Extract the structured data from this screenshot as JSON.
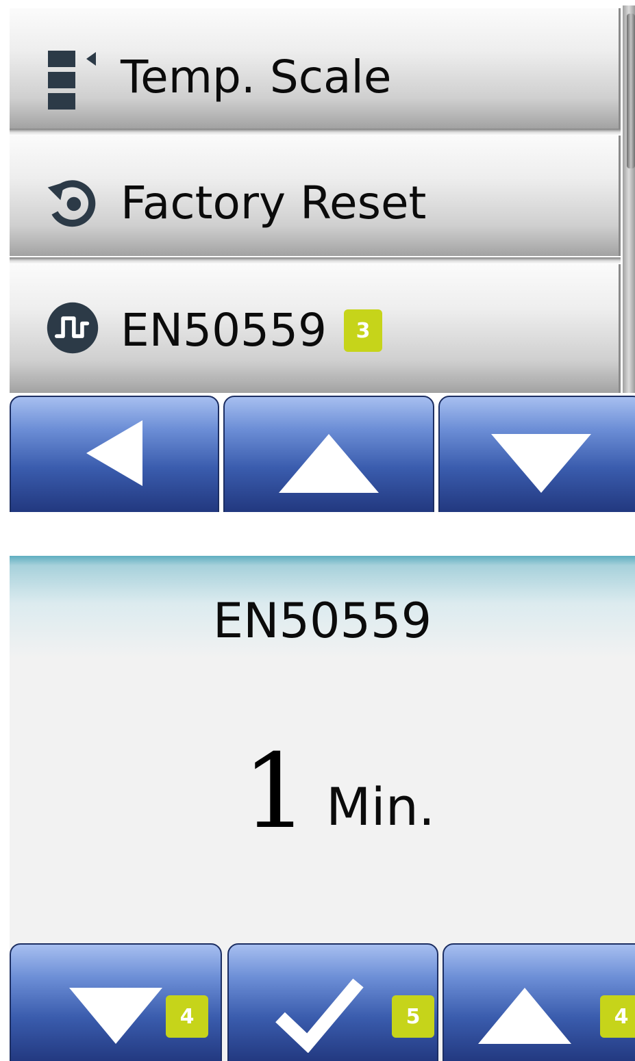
{
  "panel1": {
    "menu": [
      {
        "label": "Temp. Scale",
        "icon": "temp-scale-icon"
      },
      {
        "label": "Factory Reset",
        "icon": "reset-icon"
      },
      {
        "label": "EN50559",
        "icon": "en50559-icon",
        "badge": "3"
      }
    ],
    "nav": [
      {
        "icon": "left-arrow-icon"
      },
      {
        "icon": "up-arrow-icon"
      },
      {
        "icon": "down-arrow-icon"
      }
    ]
  },
  "panel2": {
    "title": "EN50559",
    "value": "1",
    "unit": "Min.",
    "nav": [
      {
        "icon": "down-arrow-icon",
        "badge": "4"
      },
      {
        "icon": "check-icon",
        "badge": "5"
      },
      {
        "icon": "up-arrow-icon",
        "badge": "4"
      }
    ]
  },
  "colors": {
    "badge": "#c6d41a",
    "button_top": "#a7bff0",
    "button_bottom": "#22387f",
    "icon_dark": "#2c3a47"
  }
}
